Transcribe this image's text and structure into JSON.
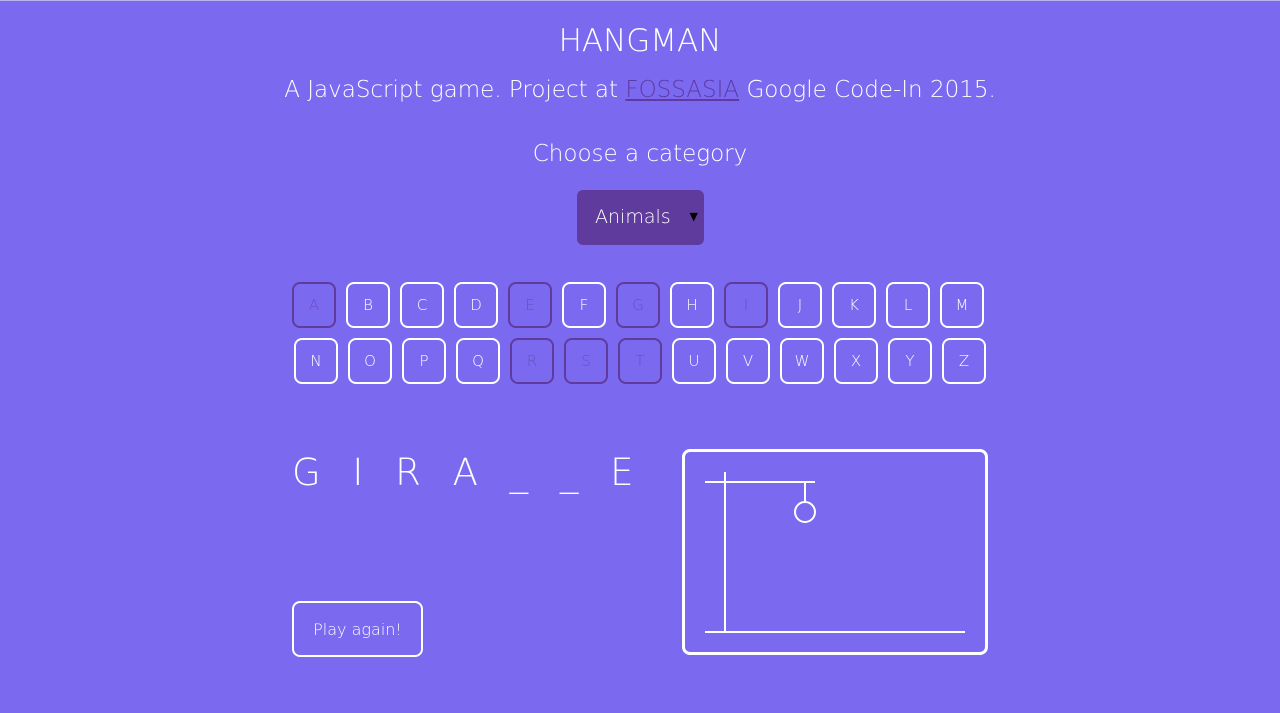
{
  "header": {
    "title": "HANGMAN",
    "subtitle_before": "A JavaScript game. Project at ",
    "subtitle_link": "FOSSASIA",
    "subtitle_after": " Google Code-In 2015."
  },
  "category": {
    "prompt": "Choose a category",
    "selected": "Animals"
  },
  "keyboard": {
    "row1": [
      {
        "letter": "A",
        "used": true
      },
      {
        "letter": "B",
        "used": false
      },
      {
        "letter": "C",
        "used": false
      },
      {
        "letter": "D",
        "used": false
      },
      {
        "letter": "E",
        "used": true
      },
      {
        "letter": "F",
        "used": false
      },
      {
        "letter": "G",
        "used": true
      },
      {
        "letter": "H",
        "used": false
      },
      {
        "letter": "I",
        "used": true
      },
      {
        "letter": "J",
        "used": false
      },
      {
        "letter": "K",
        "used": false
      },
      {
        "letter": "L",
        "used": false
      },
      {
        "letter": "M",
        "used": false
      }
    ],
    "row2": [
      {
        "letter": "N",
        "used": false
      },
      {
        "letter": "O",
        "used": false
      },
      {
        "letter": "P",
        "used": false
      },
      {
        "letter": "Q",
        "used": false
      },
      {
        "letter": "R",
        "used": true
      },
      {
        "letter": "S",
        "used": true
      },
      {
        "letter": "T",
        "used": true
      },
      {
        "letter": "U",
        "used": false
      },
      {
        "letter": "V",
        "used": false
      },
      {
        "letter": "W",
        "used": false
      },
      {
        "letter": "X",
        "used": false
      },
      {
        "letter": "Y",
        "used": false
      },
      {
        "letter": "Z",
        "used": false
      }
    ]
  },
  "game": {
    "word_display": "G I R A _ _ E",
    "play_again_label": "Play again!"
  },
  "colors": {
    "background": "#7b6af0",
    "accent": "#5f3b9e"
  }
}
